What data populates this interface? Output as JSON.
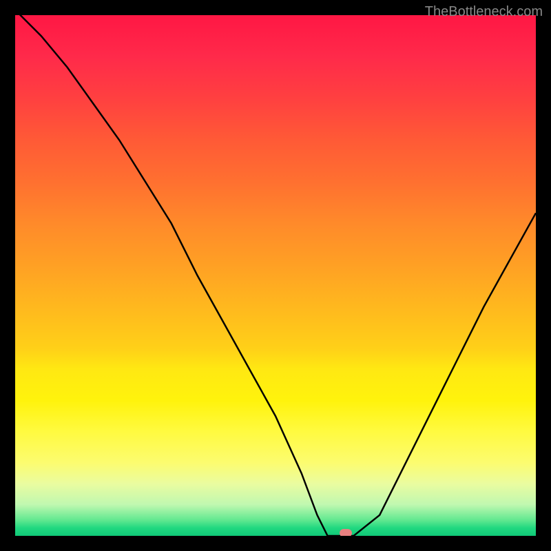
{
  "watermark": "TheBottleneck.com",
  "chart_data": {
    "type": "line",
    "title": "",
    "xlabel": "",
    "ylabel": "",
    "xlim": [
      0,
      100
    ],
    "ylim": [
      0,
      100
    ],
    "curve": {
      "name": "bottleneck-curve",
      "x": [
        0,
        5,
        10,
        15,
        20,
        25,
        30,
        35,
        40,
        45,
        50,
        55,
        58,
        60,
        62,
        65,
        70,
        75,
        80,
        85,
        90,
        95,
        100
      ],
      "y_value": [
        101,
        96,
        90,
        83,
        76,
        68,
        60,
        50,
        41,
        32,
        23,
        12,
        4,
        0,
        0,
        0,
        4,
        14,
        24,
        34,
        44,
        53,
        62
      ]
    },
    "optimum_marker": {
      "x": 63.5,
      "y": 0
    },
    "background": {
      "type": "vertical-gradient",
      "stops": [
        {
          "pos": 0.0,
          "color": "#ff1744"
        },
        {
          "pos": 0.5,
          "color": "#ffb020"
        },
        {
          "pos": 0.8,
          "color": "#fffa40"
        },
        {
          "pos": 0.95,
          "color": "#90f0a0"
        },
        {
          "pos": 1.0,
          "color": "#10c878"
        }
      ]
    }
  }
}
